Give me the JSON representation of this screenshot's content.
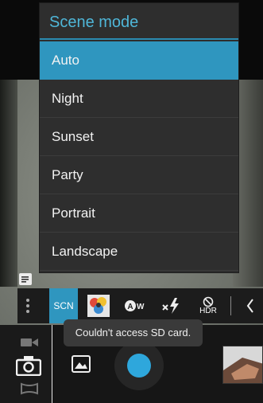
{
  "scene_menu": {
    "title": "Scene mode",
    "items": [
      "Auto",
      "Night",
      "Sunset",
      "Party",
      "Portrait",
      "Landscape"
    ],
    "selected": "Auto"
  },
  "toolbar": {
    "scn_label": "SCN",
    "hdr_label": "HDR",
    "icons": [
      "more-vert-icon",
      "scene-mode-button",
      "color-effect-icon",
      "white-balance-icon",
      "flash-auto-icon",
      "hdr-off-icon",
      "collapse-chevron-icon"
    ]
  },
  "controls": {
    "modes": [
      "video-camera-icon",
      "camera-icon",
      "panorama-icon"
    ]
  },
  "toast": {
    "message": "Couldn't access SD card."
  },
  "colors": {
    "accent": "#2f96bf",
    "title": "#4fb6d8",
    "shutter": "#2ea7dc",
    "menu_bg": "#2e2e2e"
  }
}
